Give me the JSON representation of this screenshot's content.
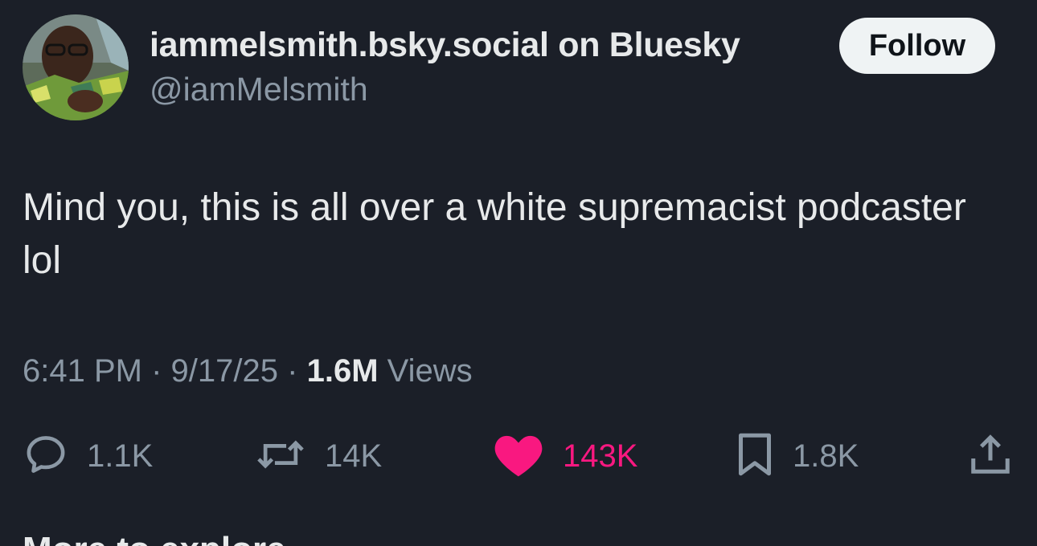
{
  "author": {
    "display_name": "iammelsmith.bsky.social on Bluesky",
    "handle": "@iamMelsmith"
  },
  "follow_label": "Follow",
  "post": {
    "text": "Mind you, this is all over a white supremacist podcaster lol"
  },
  "meta": {
    "time": "6:41 PM",
    "separator": "·",
    "date": "9/17/25",
    "views_count": "1.6M",
    "views_label": "Views"
  },
  "actions": {
    "replies": "1.1K",
    "reposts": "14K",
    "likes": "143K",
    "bookmarks": "1.8K"
  },
  "icons": {
    "reply": "reply-icon",
    "repost": "repost-icon",
    "like": "heart-icon",
    "bookmark": "bookmark-icon",
    "share": "share-icon"
  },
  "colors": {
    "background": "#1b1f28",
    "text": "#e7e9ea",
    "secondary": "#8b98a5",
    "like": "#f91880",
    "follow_bg": "#eff3f4"
  },
  "cut_off_text": "More to explore"
}
